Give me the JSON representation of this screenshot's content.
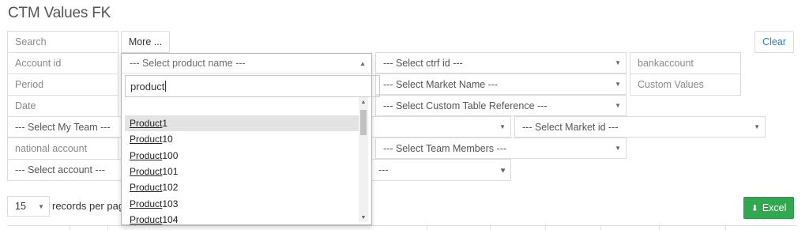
{
  "page": {
    "title": "CTM Values FK"
  },
  "toolbar": {
    "more_label": "More ...",
    "clear_label": "Clear",
    "excel_label": "Excel"
  },
  "filters": {
    "search_placeholder": "Search",
    "account_id_placeholder": "Account id",
    "period_placeholder": "Period",
    "date_placeholder": "Date",
    "my_team": "--- Select My Team ---",
    "national_account_placeholder": "national account",
    "account": "--- Select account ---",
    "product_name": "--- Select product name ---",
    "ctrf_id": "--- Select ctrf id ---",
    "market_name": "--- Select Market Name ---",
    "custom_table_reference": "--- Select Custom Table Reference ---",
    "market_id": "--- Select Market id ---",
    "team_members": "--- Select Team Members ---",
    "last_select": "---",
    "bankaccount_placeholder": "bankaccount",
    "custom_values_placeholder": "Custom Values"
  },
  "dropdown": {
    "search_value": "product",
    "highlight": "Product",
    "options": [
      {
        "match": "Product",
        "rest": "1"
      },
      {
        "match": "Product",
        "rest": "10"
      },
      {
        "match": "Product",
        "rest": "100"
      },
      {
        "match": "Product",
        "rest": "101"
      },
      {
        "match": "Product",
        "rest": "102"
      },
      {
        "match": "Product",
        "rest": "103"
      },
      {
        "match": "Product",
        "rest": "104"
      }
    ]
  },
  "pagination": {
    "page_size": "15",
    "records_label": "records per page"
  },
  "colors": {
    "excel_green": "#2fa84f",
    "clear_blue": "#2f7dc1"
  }
}
